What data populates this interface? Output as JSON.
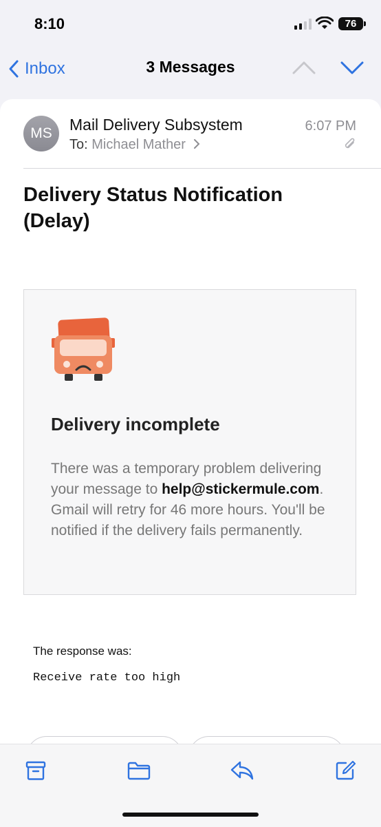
{
  "status_bar": {
    "time": "8:10",
    "battery": "76"
  },
  "nav": {
    "back_label": "Inbox",
    "title": "3 Messages"
  },
  "message": {
    "avatar_initials": "MS",
    "sender": "Mail Delivery Subsystem",
    "to_label": "To:",
    "to_name": "Michael Mather",
    "time": "6:07 PM",
    "subject": "Delivery Status Notification (Delay)"
  },
  "card": {
    "title": "Delivery incomplete",
    "body_before": "There was a temporary problem delivering your message to ",
    "body_email": "help@stickermule.com",
    "body_after": ". Gmail will retry for 46 more hours. You'll be notified if the delivery fails permanently."
  },
  "response": {
    "label": "The response was:",
    "text": "Receive rate too high"
  },
  "toolbar": [
    "archive-icon",
    "folder-icon",
    "reply-icon",
    "compose-icon"
  ],
  "colors": {
    "accent": "#2f73e0",
    "truck": "#e8643c"
  }
}
